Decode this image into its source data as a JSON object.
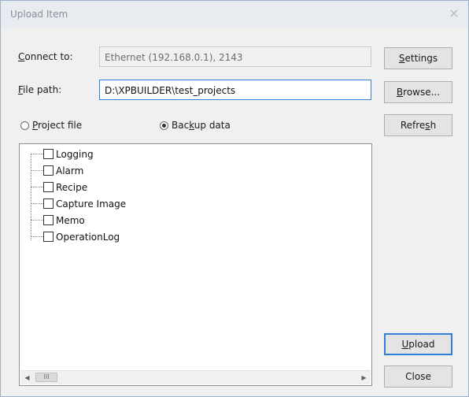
{
  "dialog": {
    "title": "Upload Item",
    "close_glyph": "×"
  },
  "connect": {
    "label_underline": "C",
    "label_rest": "onnect to:",
    "value": "Ethernet (192.168.0.1), 2143"
  },
  "filepath": {
    "label_underline": "F",
    "label_rest": "ile path:",
    "value": "D:\\XPBUILDER\\test_projects"
  },
  "radios": {
    "project": {
      "underline": "P",
      "rest": "roject file",
      "selected": false
    },
    "backup": {
      "pre": "Bac",
      "underline": "k",
      "rest": "up data",
      "selected": true
    }
  },
  "buttons": {
    "settings": {
      "underline": "S",
      "rest": "ettings"
    },
    "browse": {
      "underline": "B",
      "rest": "rowse..."
    },
    "refresh": {
      "pre": "Refre",
      "underline": "s",
      "rest": "h"
    },
    "upload": {
      "underline": "U",
      "rest": "pload"
    },
    "close": {
      "label": "Close"
    }
  },
  "tree": {
    "items": [
      {
        "label": "Logging",
        "checked": false
      },
      {
        "label": "Alarm",
        "checked": false
      },
      {
        "label": "Recipe",
        "checked": false
      },
      {
        "label": "Capture Image",
        "checked": false
      },
      {
        "label": "Memo",
        "checked": false
      },
      {
        "label": "OperationLog",
        "checked": false
      }
    ]
  },
  "scrollbar": {
    "left_icon": "scroll-left-arrow-icon",
    "right_icon": "scroll-right-arrow-icon",
    "left_glyph": "◀",
    "right_glyph": "▶",
    "thumb_glyph": "III"
  },
  "colors": {
    "accent": "#2f7fd6",
    "titlebar": "#e8ebf0",
    "dialog_bg": "#f0f0f0"
  }
}
